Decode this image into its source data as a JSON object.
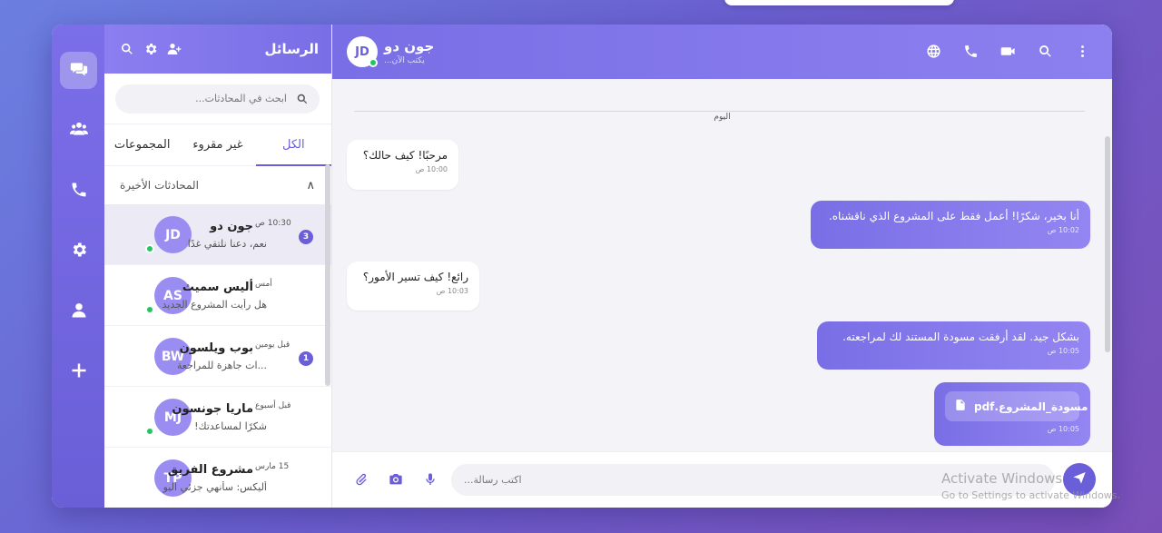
{
  "sidebar": {
    "title": "الرسائل",
    "search_placeholder": "ابحث في المحادثات...",
    "tabs": [
      {
        "label": "المجموعات"
      },
      {
        "label": "غير مقروء"
      },
      {
        "label": "الكل"
      }
    ],
    "section_title": "المحادثات الأخيرة",
    "section_toggle": "∧",
    "conversations": [
      {
        "initials": "JD",
        "name": "جون دو",
        "preview": "نعم، دعنا نلتقي غدًا",
        "time": "10:30 ص",
        "badge": "3",
        "online": true,
        "active": true
      },
      {
        "initials": "AS",
        "name": "أليس سميث",
        "preview": "هل رأيت المشروع الجديد؟",
        "time": "أمس",
        "badge": "",
        "online": true,
        "active": false
      },
      {
        "initials": "BW",
        "name": "بوب ويلسون",
        "preview": "...ات جاهزة للمراجعة",
        "time": "قبل يومين",
        "badge": "1",
        "online": false,
        "active": false
      },
      {
        "initials": "MJ",
        "name": "ماريا جونسون",
        "preview": "شكرًا لمساعدتك!",
        "time": "قبل أسبوع",
        "badge": "",
        "online": true,
        "active": false
      },
      {
        "initials": "TP",
        "name": "مشروع الفريق",
        "preview": "أليكس: سأنهي جزئي اليوم",
        "time": "15 مارس",
        "badge": "",
        "online": false,
        "active": false
      }
    ]
  },
  "chat": {
    "contact_initials": "JD",
    "contact_name": "جون دو",
    "contact_status": "يكتب الآن...",
    "day_label": "اليوم",
    "messages": [
      {
        "dir": "in",
        "text": "مرحبًا! كيف حالك؟",
        "time": "10:00 ص"
      },
      {
        "dir": "out",
        "text": "أنا بخير، شكرًا! أعمل فقط على المشروع الذي ناقشناه.",
        "time": "10:02 ص"
      },
      {
        "dir": "in",
        "text": "رائع! كيف تسير الأمور؟",
        "time": "10:03 ص"
      },
      {
        "dir": "out",
        "text": "بشكل جيد. لقد أرفقت مسودة المستند لك لمراجعته.",
        "time": "10:05 ص"
      },
      {
        "dir": "out",
        "file": "مسودة_المشروع.pdf",
        "time": "10:05 ص"
      }
    ],
    "composer_placeholder": "اكتب رسالة..."
  },
  "watermark": {
    "title": "Activate Windows",
    "subtitle": "Go to Settings to activate Windows."
  },
  "icons": {
    "rail": [
      "chat-icon",
      "users-icon",
      "phone-icon",
      "settings-icon",
      "user-icon",
      "plus-icon"
    ],
    "header": [
      "globe-icon",
      "phone-icon",
      "video-icon",
      "search-icon",
      "more-icon"
    ]
  },
  "colors": {
    "accent": "#6a5fd8",
    "online": "#22c55e"
  }
}
